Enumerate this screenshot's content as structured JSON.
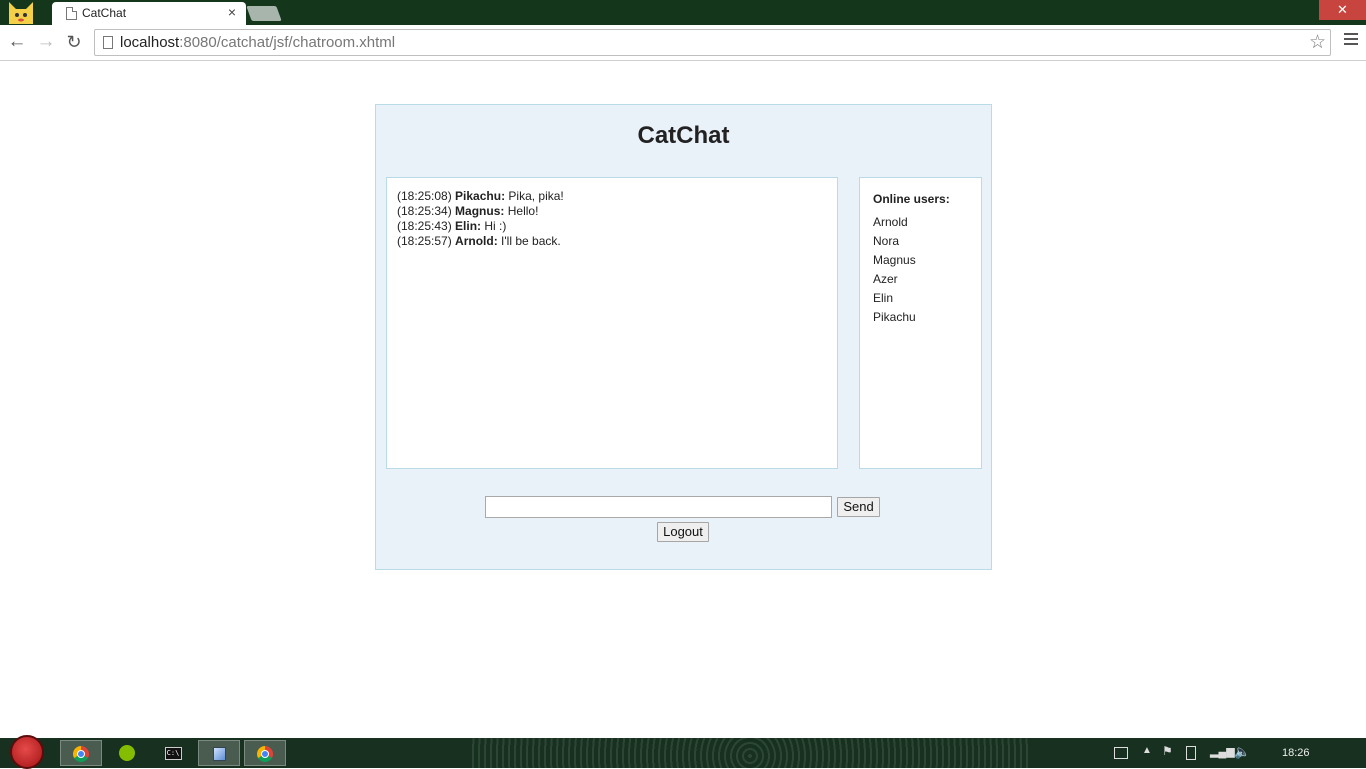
{
  "browser": {
    "tab_title": "CatChat",
    "tab_close": "×",
    "window_close": "✕",
    "url_host": "localhost",
    "url_rest": ":8080/catchat/jsf/chatroom.xhtml"
  },
  "page": {
    "title": "CatChat",
    "messages": [
      {
        "time": "(18:25:08)",
        "user": "Pikachu:",
        "text": "Pika, pika!"
      },
      {
        "time": "(18:25:34)",
        "user": "Magnus:",
        "text": "Hello!"
      },
      {
        "time": "(18:25:43)",
        "user": "Elin:",
        "text": "Hi :)"
      },
      {
        "time": "(18:25:57)",
        "user": "Arnold:",
        "text": "I'll be back."
      }
    ],
    "users_title": "Online users:",
    "users": [
      "Arnold",
      "Nora",
      "Magnus",
      "Azer",
      "Elin",
      "Pikachu"
    ],
    "message_input_value": "",
    "send_label": "Send",
    "logout_label": "Logout"
  },
  "taskbar": {
    "clock": "18:26"
  }
}
